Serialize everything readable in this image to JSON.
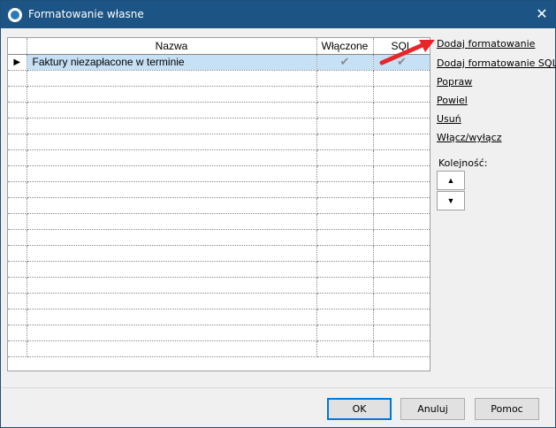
{
  "window": {
    "title": "Formatowanie własne",
    "close_symbol": "✕"
  },
  "grid": {
    "columns": [
      "",
      "Nazwa",
      "Włączone",
      "SQL"
    ],
    "rows": [
      {
        "indicator": "▶",
        "name": "Faktury niezapłacone w terminie",
        "enabled": "✔",
        "sql": "✔"
      }
    ],
    "empty_rows": 18
  },
  "actions": {
    "add_formatting": "Dodaj formatowanie",
    "add_sql_formatting": "Dodaj formatowanie SQL",
    "edit": "Popraw",
    "duplicate": "Powiel",
    "delete": "Usuń",
    "toggle": "Włącz/wyłącz"
  },
  "order": {
    "label": "Kolejność:",
    "up_symbol": "▲",
    "down_symbol": "▼"
  },
  "buttons": {
    "ok": "OK",
    "cancel": "Anuluj",
    "help": "Pomoc"
  },
  "colors": {
    "titlebar": "#1c5585",
    "selected_row": "#c6e0f5",
    "annotation_arrow": "#e8262a"
  },
  "icons": {
    "app": "app-logo-icon",
    "close": "close-icon",
    "row_indicator": "row-pointer-icon",
    "check": "checkmark-icon",
    "up": "arrow-up-icon",
    "down": "arrow-down-icon"
  }
}
